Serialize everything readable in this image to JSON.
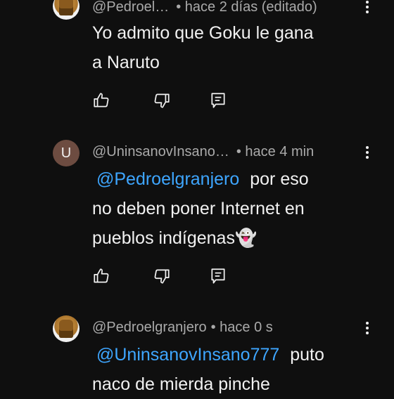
{
  "comments": [
    {
      "avatar": "image",
      "handle": "@Pedroel…",
      "meta": "• hace 2 días (editado)",
      "mention": "",
      "text_lines": [
        "Yo admito que Goku le gana",
        "a Naruto"
      ]
    },
    {
      "avatar": "U",
      "handle": "@UninsanovInsano…",
      "meta": "• hace 4 min",
      "mention": "@Pedroelgranjero",
      "text_lines": [
        "por eso",
        "no deben poner Internet en",
        "pueblos indígenas👻"
      ]
    },
    {
      "avatar": "image",
      "handle": "@Pedroelgranjero",
      "meta": "• hace 0 s",
      "mention": "@UninsanovInsano777",
      "text_lines": [
        "puto",
        "naco de mierda pinche"
      ]
    }
  ],
  "icons": {
    "like": "thumbs-up-icon",
    "dislike": "thumbs-down-icon",
    "reply": "reply-comment-icon",
    "more": "more-vert-icon"
  },
  "colors": {
    "background": "#0f0f0f",
    "text": "#f1f1f1",
    "secondary": "#aaaaaa",
    "mention": "#3ea6ff",
    "avatar_u": "#6d4c41"
  }
}
